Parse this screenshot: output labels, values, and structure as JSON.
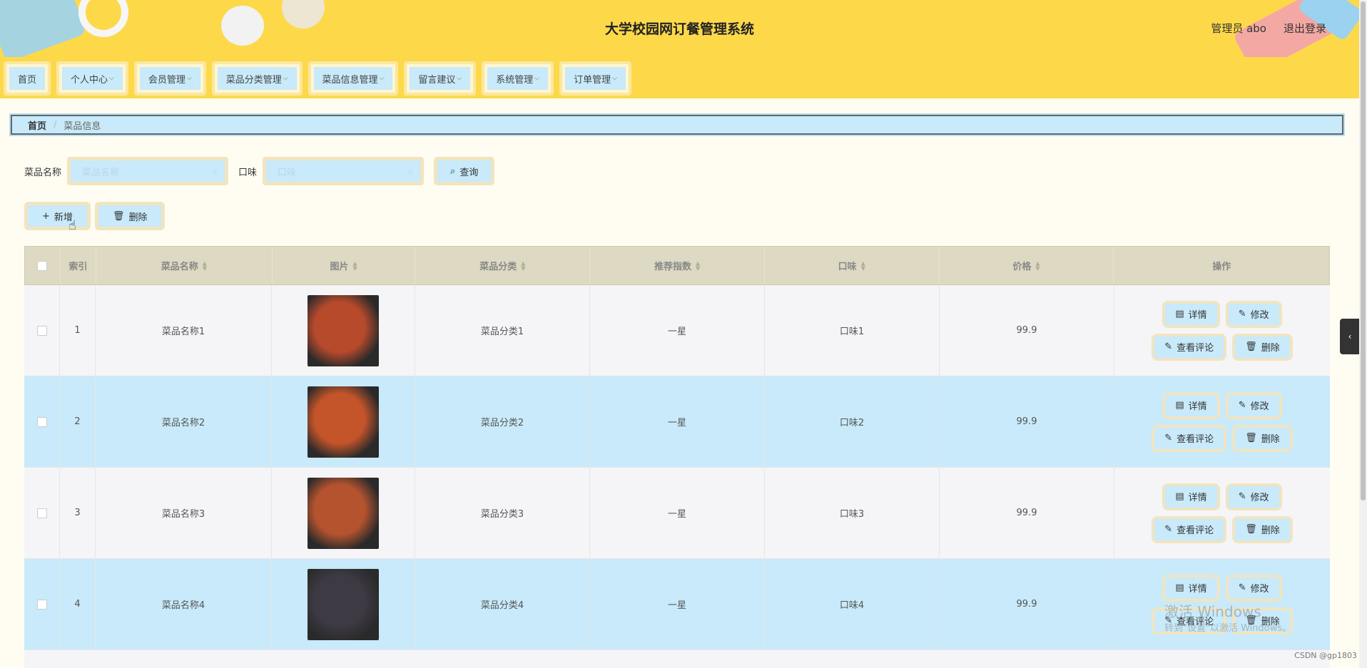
{
  "header": {
    "title": "大学校园网订餐管理系统",
    "user": "管理员 abo",
    "logout": "退出登录"
  },
  "nav": [
    {
      "label": "首页",
      "dropdown": false
    },
    {
      "label": "个人中心",
      "dropdown": true
    },
    {
      "label": "会员管理",
      "dropdown": true
    },
    {
      "label": "菜品分类管理",
      "dropdown": true
    },
    {
      "label": "菜品信息管理",
      "dropdown": true
    },
    {
      "label": "留言建议",
      "dropdown": true
    },
    {
      "label": "系统管理",
      "dropdown": true
    },
    {
      "label": "订单管理",
      "dropdown": true
    }
  ],
  "breadcrumb": {
    "home": "首页",
    "sep": "/",
    "current": "菜品信息"
  },
  "search": {
    "name_label": "菜品名称",
    "name_placeholder": "菜品名称",
    "taste_label": "口味",
    "taste_placeholder": "口味",
    "query_label": "查询"
  },
  "actions": {
    "add": "新增",
    "delete": "删除"
  },
  "table": {
    "headers": [
      "索引",
      "菜品名称",
      "图片",
      "菜品分类",
      "推荐指数",
      "口味",
      "价格",
      "操作"
    ],
    "rows": [
      {
        "index": "1",
        "name": "菜品名称1",
        "category": "菜品分类1",
        "rating": "一星",
        "taste": "口味1",
        "price": "99.9",
        "image_color": "#b84a2c"
      },
      {
        "index": "2",
        "name": "菜品名称2",
        "category": "菜品分类2",
        "rating": "一星",
        "taste": "口味2",
        "price": "99.9",
        "image_color": "#c4542a"
      },
      {
        "index": "3",
        "name": "菜品名称3",
        "category": "菜品分类3",
        "rating": "一星",
        "taste": "口味3",
        "price": "99.9",
        "image_color": "#b5532f"
      },
      {
        "index": "4",
        "name": "菜品名称4",
        "category": "菜品分类4",
        "rating": "一星",
        "taste": "口味4",
        "price": "99.9",
        "image_color": "#3d3a44"
      }
    ],
    "ops": {
      "detail": "详情",
      "edit": "修改",
      "comments": "查看评论",
      "delete": "删除"
    }
  },
  "watermark": {
    "line1": "激活 Windows",
    "line2": "转到\"设置\"以激活 Windows。"
  },
  "credit": "CSDN @gp1803"
}
